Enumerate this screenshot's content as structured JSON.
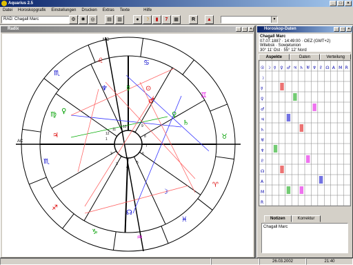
{
  "window": {
    "title": "Aquarius 2.5"
  },
  "menu": [
    "Datei",
    "Horoskopgrafik",
    "Einstellungen",
    "Drucken",
    "Extras",
    "Texte",
    "Hilfe"
  ],
  "toolbar": {
    "person_combo": "RAD: Chagall Marc",
    "r_button": "R",
    "seven_button": "7",
    "filter_combo": ""
  },
  "chart_window": {
    "title": "Radix"
  },
  "chart": {
    "mc_label": "MC",
    "ac_label": "AC",
    "house_numbers": [
      "1",
      "2",
      "3",
      "4",
      "5",
      "6",
      "7",
      "8",
      "9",
      "10",
      "11",
      "12"
    ],
    "zodiac_colors": {
      "fire": "#dd0000",
      "earth": "#00a000",
      "air": "#e000e0",
      "water": "#0000cc"
    }
  },
  "data_window": {
    "title": "Horoskop-Daten",
    "name": "Chagall Marc",
    "line1": "07.07.1887 · 14:49:00 · OEZ (GMT+2)",
    "line2": "Witebsk · Sowjetunion",
    "line3": "30° 11' Ost · 55° 12' Nord",
    "tabs": [
      "Aspekte",
      "Daten",
      "Verteilung"
    ],
    "notes_tabs": [
      "Notizen",
      "Korrektur"
    ],
    "notes_text": "Chagall Marc"
  },
  "status": {
    "date": "26.03.2002",
    "time": "21:40"
  }
}
